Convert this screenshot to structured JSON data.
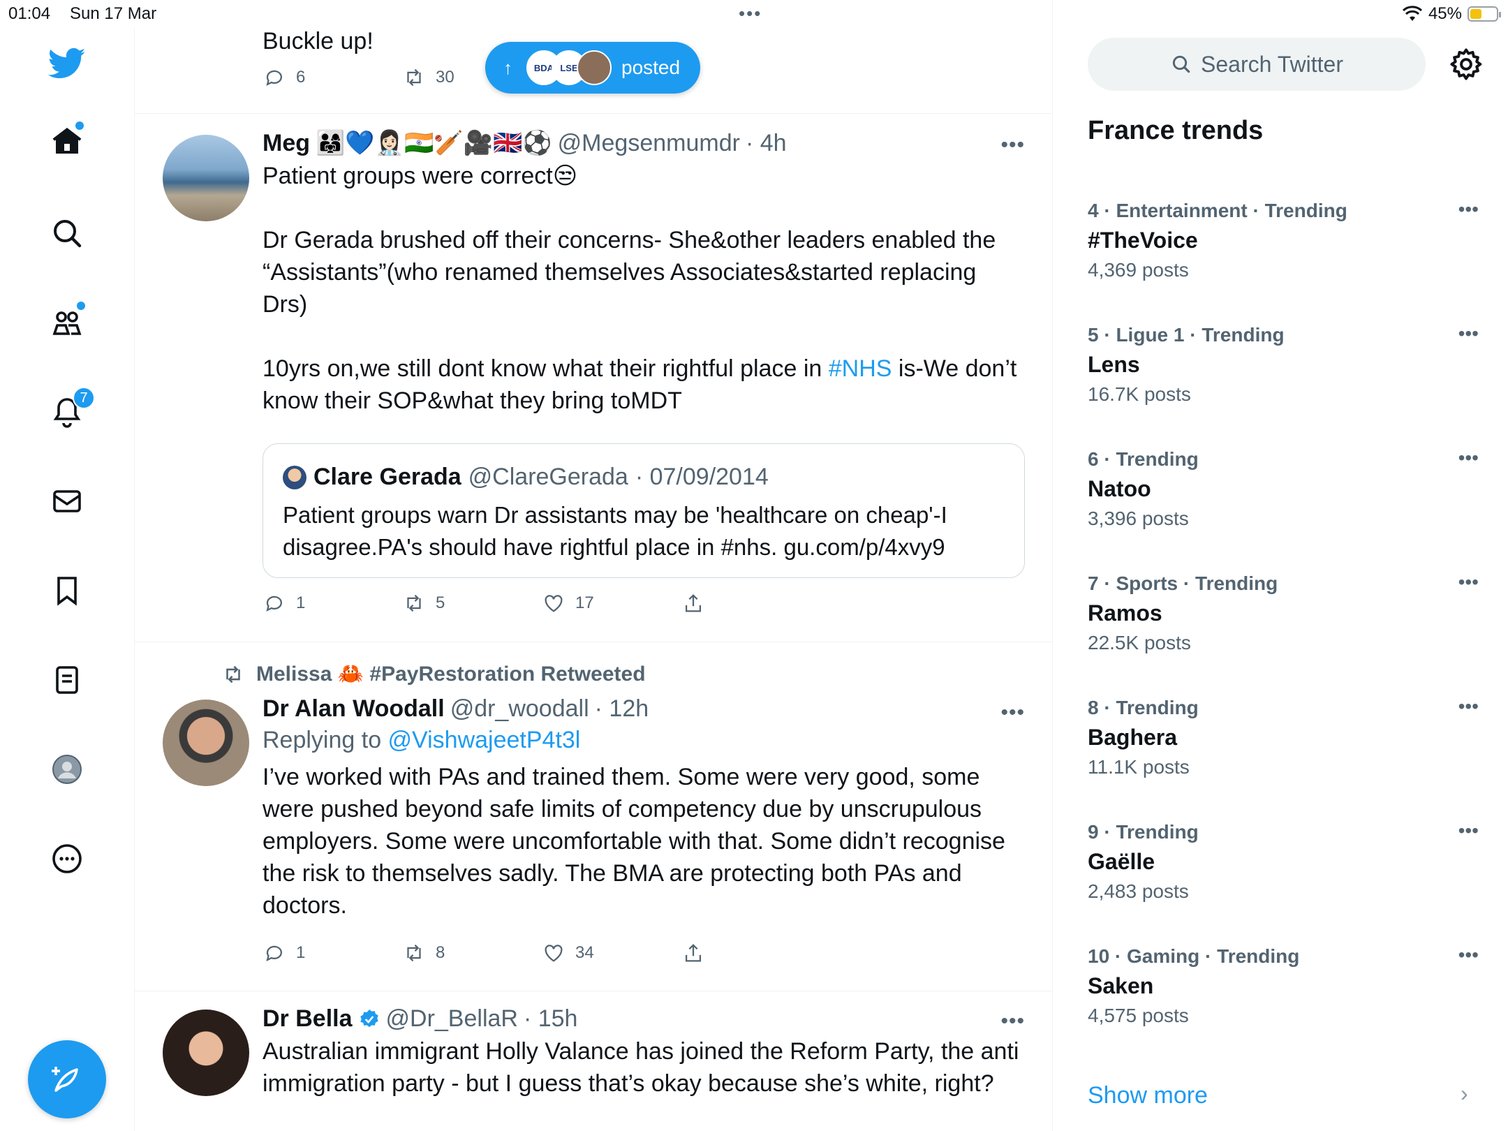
{
  "status": {
    "time": "01:04",
    "date": "Sun 17 Mar",
    "battery": "45%",
    "battery_level": 0.45
  },
  "nav": {
    "people_dot": true,
    "notifications_count": "7"
  },
  "pill": {
    "label": "posted",
    "avatar1": "BDA",
    "avatar2": "LSE"
  },
  "tweet0": {
    "text": "Buckle up!",
    "replies": "6",
    "retweets": "30"
  },
  "tweet1": {
    "name": "Meg",
    "emojis": "👨‍👩‍👧💙👩🏻‍⚕️🇮🇳🏏🎥🇬🇧⚽",
    "handle": "@Megsenmumdr",
    "time": "· 4h",
    "line1": "Patient groups were correct😒",
    "para2": "Dr Gerada brushed off their concerns- She&other leaders enabled the “Assistants”(who renamed themselves Associates&started replacing Drs)",
    "para3_pre": "10yrs on,we still dont know what their rightful place in ",
    "para3_link": "#NHS",
    "para3_post": " is-We don’t know their SOP&what they bring toMDT",
    "quote": {
      "name": "Clare Gerada",
      "handle": "@ClareGerada",
      "date": "· 07/09/2014",
      "text": "Patient groups warn Dr assistants may be 'healthcare on cheap'-I disagree.PA's should have rightful place in #nhs.  gu.com/p/4xvy9"
    },
    "replies": "1",
    "retweets": "5",
    "likes": "17"
  },
  "tweet2": {
    "retweeted_by": "Melissa 🦀 #PayRestoration Retweeted",
    "name": "Dr Alan Woodall",
    "handle": "@dr_woodall",
    "time": "· 12h",
    "replying_label": "Replying to ",
    "replying_to": "@VishwajeetP4t3l",
    "text": "I’ve worked with PAs and  trained them. Some were very good, some were pushed beyond safe limits of competency due by unscrupulous employers. Some were uncomfortable with that. Some didn’t recognise the risk to themselves sadly. The BMA are protecting both PAs and doctors.",
    "replies": "1",
    "retweets": "8",
    "likes": "34"
  },
  "tweet3": {
    "name": "Dr Bella",
    "handle": "@Dr_BellaR",
    "time": "· 15h",
    "text": "Australian immigrant Holly Valance has joined the Reform Party, the anti immigration party - but I guess that’s okay because she’s white, right?"
  },
  "right": {
    "search_placeholder": "Search Twitter",
    "trends_title": "France trends",
    "trends": [
      {
        "meta": "4 · Entertainment · Trending",
        "name": "#TheVoice",
        "count": "4,369 posts"
      },
      {
        "meta": "5 · Ligue 1 · Trending",
        "name": "Lens",
        "count": "16.7K posts"
      },
      {
        "meta": "6 · Trending",
        "name": "Natoo",
        "count": "3,396 posts"
      },
      {
        "meta": "7 · Sports · Trending",
        "name": "Ramos",
        "count": "22.5K posts"
      },
      {
        "meta": "8 · Trending",
        "name": "Baghera",
        "count": "11.1K posts"
      },
      {
        "meta": "9 · Trending",
        "name": "Gaëlle",
        "count": "2,483 posts"
      },
      {
        "meta": "10 · Gaming · Trending",
        "name": "Saken",
        "count": "4,575 posts"
      }
    ],
    "show_more": "Show more"
  },
  "colors": {
    "accent": "#1d9bf0",
    "text": "#0f1419",
    "muted": "#536471",
    "border": "#eff3f4"
  }
}
